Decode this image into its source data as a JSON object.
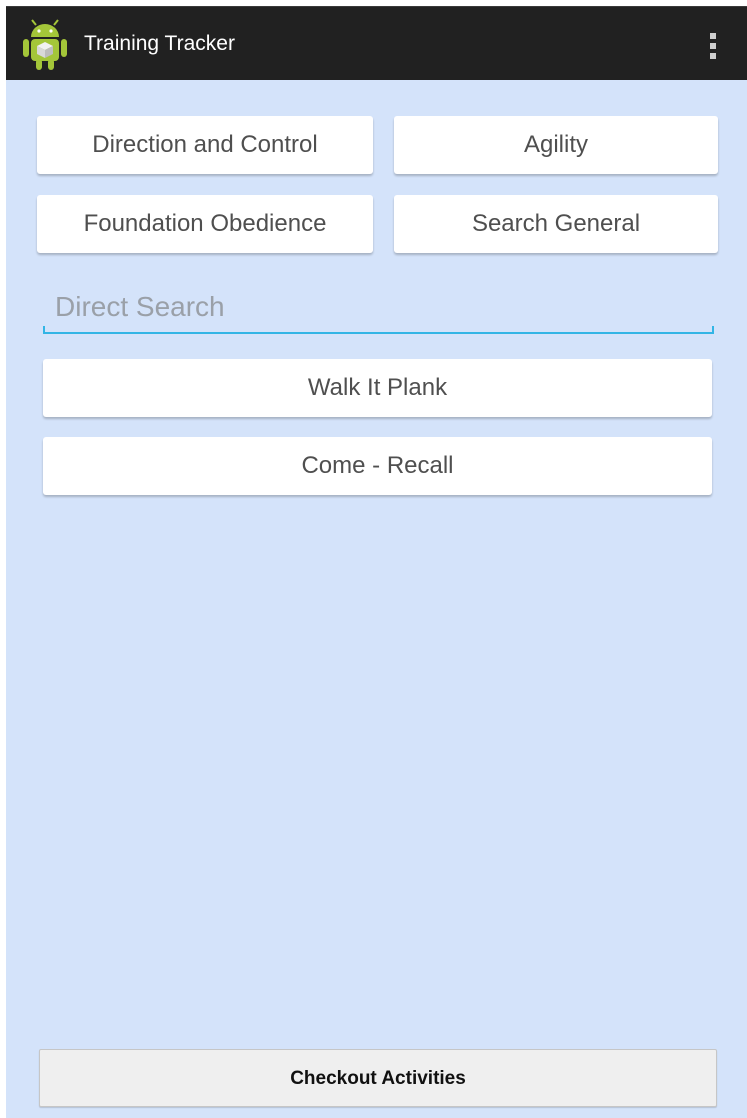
{
  "app": {
    "title": "Training Tracker",
    "icon": "android-robot-icon",
    "menu_icon": "overflow-menu-icon"
  },
  "categories": [
    {
      "label": "Direction and Control"
    },
    {
      "label": "Agility"
    },
    {
      "label": "Foundation Obedience"
    },
    {
      "label": "Search General"
    }
  ],
  "search": {
    "value": "",
    "placeholder": "Direct Search"
  },
  "activities": [
    {
      "label": "Walk It Plank"
    },
    {
      "label": "Come - Recall"
    }
  ],
  "footer": {
    "checkout_label": "Checkout Activities"
  },
  "colors": {
    "action_bar": "#212121",
    "background": "#d4e3fa",
    "accent": "#33b5e5",
    "android_green": "#a4c639"
  }
}
